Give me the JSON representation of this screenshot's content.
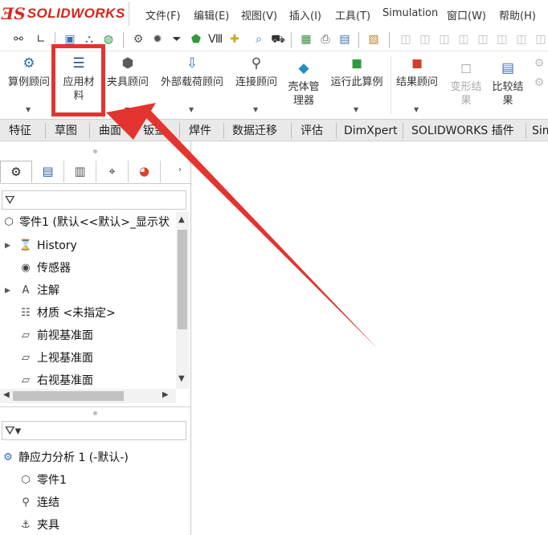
{
  "logo": {
    "mark": "ƎS",
    "text": "SOLIDWORKS"
  },
  "menu": {
    "items": [
      "文件(F)",
      "编辑(E)",
      "视图(V)",
      "插入(I)",
      "工具(T)",
      "Simulation",
      "窗口(W)",
      "帮助(H)"
    ]
  },
  "ribbon": {
    "buttons": [
      {
        "label": "算例顾问",
        "icon": "study-advisor-icon",
        "glyph": "⚙",
        "color": "#2a6fb5"
      },
      {
        "label": "应用材\n料",
        "icon": "apply-material-icon",
        "glyph": "☰",
        "color": "#1f4f8a"
      },
      {
        "label": "夹具顾问",
        "icon": "fixtures-advisor-icon",
        "glyph": "⬢",
        "color": "#5a5a5a"
      },
      {
        "label": "外部载荷顾问",
        "icon": "external-loads-icon",
        "glyph": "⇩",
        "color": "#3b6fb5"
      },
      {
        "label": "连接顾问",
        "icon": "connections-advisor-icon",
        "glyph": "⚲",
        "color": "#4a4a4a"
      },
      {
        "label": "壳体管\n理器",
        "icon": "shell-manager-icon",
        "glyph": "◆",
        "color": "#1f8fc7"
      },
      {
        "label": "运行此算例",
        "icon": "run-study-icon",
        "glyph": "◼",
        "color": "#2f9a3b"
      },
      {
        "label": "结果顾问",
        "icon": "results-advisor-icon",
        "glyph": "◼",
        "color": "#d13f2a"
      },
      {
        "label": "变形结\n果",
        "icon": "deformed-result-icon",
        "glyph": "◻",
        "color": "#aaaaaa",
        "disabled": true
      },
      {
        "label": "比较结\n果",
        "icon": "compare-results-icon",
        "glyph": "▤",
        "color": "#3a6fb0"
      }
    ]
  },
  "tabs": [
    "特征",
    "草图",
    "曲面",
    "钣金",
    "焊件",
    "数据迁移",
    "评估",
    "DimXpert",
    "SOLIDWORKS 插件",
    "Sim"
  ],
  "tree": {
    "part": "零件1 (默认<<默认>_显示状",
    "items": [
      {
        "label": "History",
        "icon": "history-folder-icon",
        "glyph": "⌛",
        "expandable": true
      },
      {
        "label": "传感器",
        "icon": "sensors-folder-icon",
        "glyph": "◉",
        "expandable": false
      },
      {
        "label": "注解",
        "icon": "annotations-folder-icon",
        "glyph": "A",
        "expandable": true
      },
      {
        "label": "材质 <未指定>",
        "icon": "material-icon",
        "glyph": "☷",
        "expandable": false
      },
      {
        "label": "前视基准面",
        "icon": "plane-icon",
        "glyph": "▱",
        "expandable": false
      },
      {
        "label": "上视基准面",
        "icon": "plane-icon",
        "glyph": "▱",
        "expandable": false
      },
      {
        "label": "右视基准面",
        "icon": "plane-icon",
        "glyph": "▱",
        "expandable": false
      }
    ]
  },
  "simtree": {
    "study": "静应力分析 1 (-默认-)",
    "items": [
      {
        "label": "零件1",
        "icon": "part-icon",
        "glyph": "⬡"
      },
      {
        "label": "连结",
        "icon": "connections-icon",
        "glyph": "⚲"
      },
      {
        "label": "夹具",
        "icon": "fixtures-icon",
        "glyph": "⚓"
      }
    ]
  },
  "colors": {
    "highlight": "#e3342f",
    "brand": "#d9231b"
  }
}
